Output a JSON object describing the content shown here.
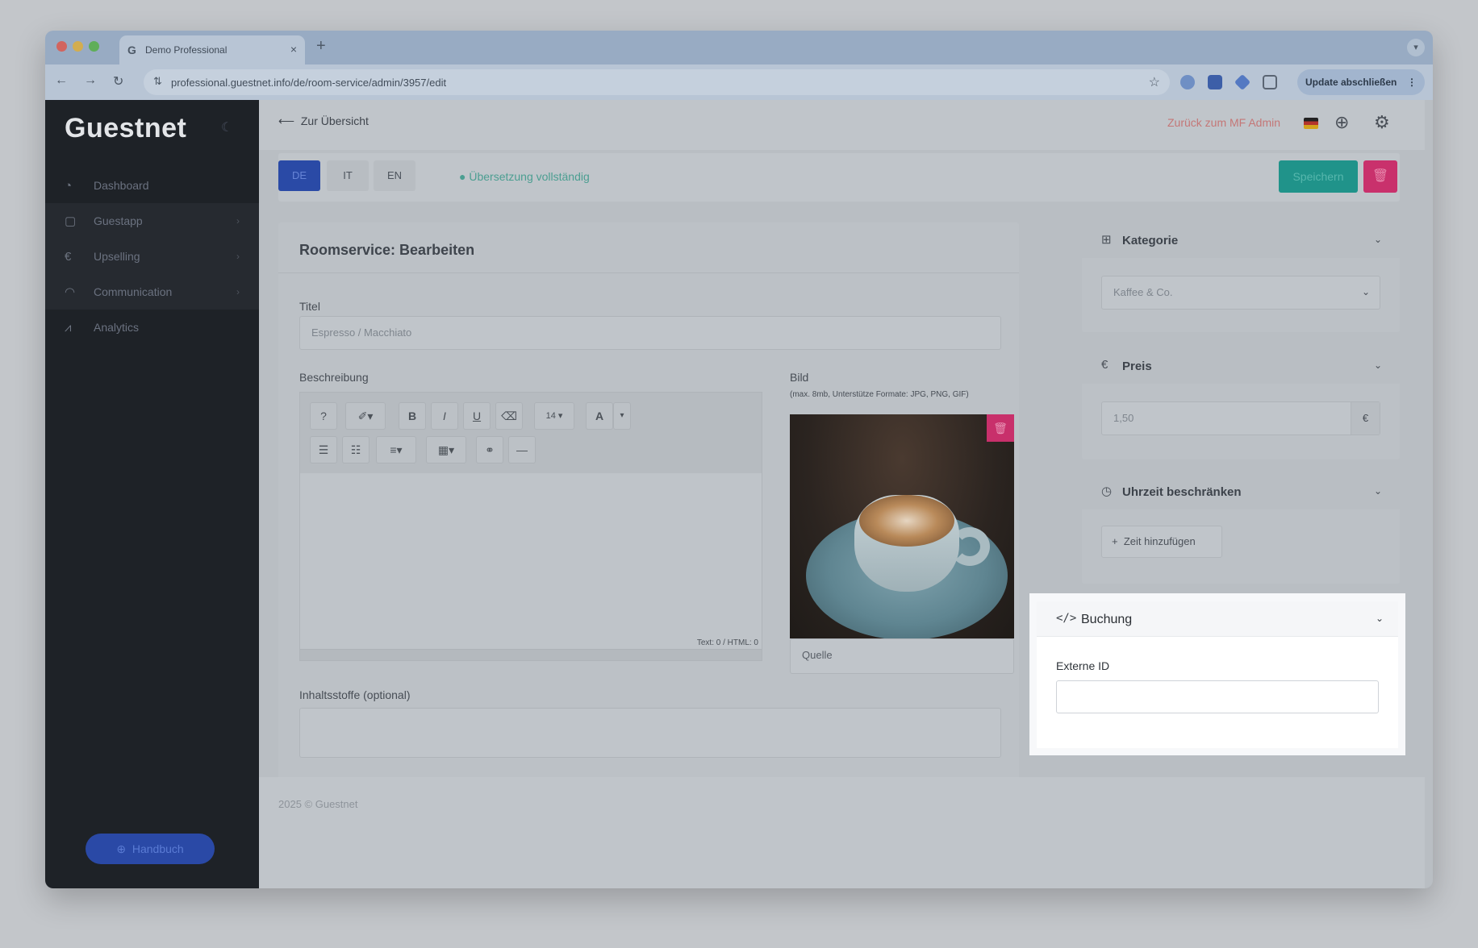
{
  "browser": {
    "tab_title": "Demo Professional",
    "favicon": "G",
    "url": "professional.guestnet.info/de/room-service/admin/3957/edit",
    "update_button": "Update abschließen"
  },
  "sidebar": {
    "logo": "Guestnet",
    "items": [
      {
        "label": "Dashboard",
        "icon": "dashboard-icon"
      },
      {
        "label": "Guestapp",
        "icon": "guestapp-icon"
      },
      {
        "label": "Upselling",
        "icon": "euro-icon"
      },
      {
        "label": "Communication",
        "icon": "rss-icon"
      },
      {
        "label": "Analytics",
        "icon": "chart-icon"
      }
    ],
    "manual_button": "Handbuch"
  },
  "topbar": {
    "back_label": "Zur Übersicht",
    "admin_link": "Zurück zum MF Admin"
  },
  "langbar": {
    "languages": [
      "DE",
      "IT",
      "EN"
    ],
    "translation_status": "Übersetzung vollständig",
    "save": "Speichern"
  },
  "edit": {
    "title": "Roomservice: Bearbeiten",
    "title_label": "Titel",
    "title_value": "Espresso / Macchiato",
    "description_label": "Beschreibung",
    "counter": "Text: 0 / HTML: 0",
    "image_label": "Bild",
    "image_hint": "(max. 8mb, Unterstütze Formate: JPG, PNG, GIF)",
    "source_placeholder": "Quelle",
    "ingredients_label": "Inhaltsstoffe (optional)",
    "toolbar": {
      "help": "?",
      "magic": "✐▾",
      "bold": "B",
      "italic": "I",
      "underline": "U",
      "eraser": "⌫",
      "fontsize": "14 ▾",
      "color": "A",
      "color_caret": "▾",
      "ul": "☰",
      "ol": "☷",
      "align": "≡▾",
      "table": "▦▾",
      "link": "⚭",
      "hr": "—"
    }
  },
  "kategorie": {
    "title": "Kategorie",
    "selected": "Kaffee & Co."
  },
  "preis": {
    "title": "Preis",
    "value": "1,50",
    "currency": "€"
  },
  "uhrzeit": {
    "title": "Uhrzeit beschränken",
    "add_button": "Zeit hinzufügen"
  },
  "buchung": {
    "title": "Buchung",
    "field_label": "Externe ID",
    "field_value": ""
  },
  "footer": {
    "copyright": "2025 © Guestnet"
  }
}
